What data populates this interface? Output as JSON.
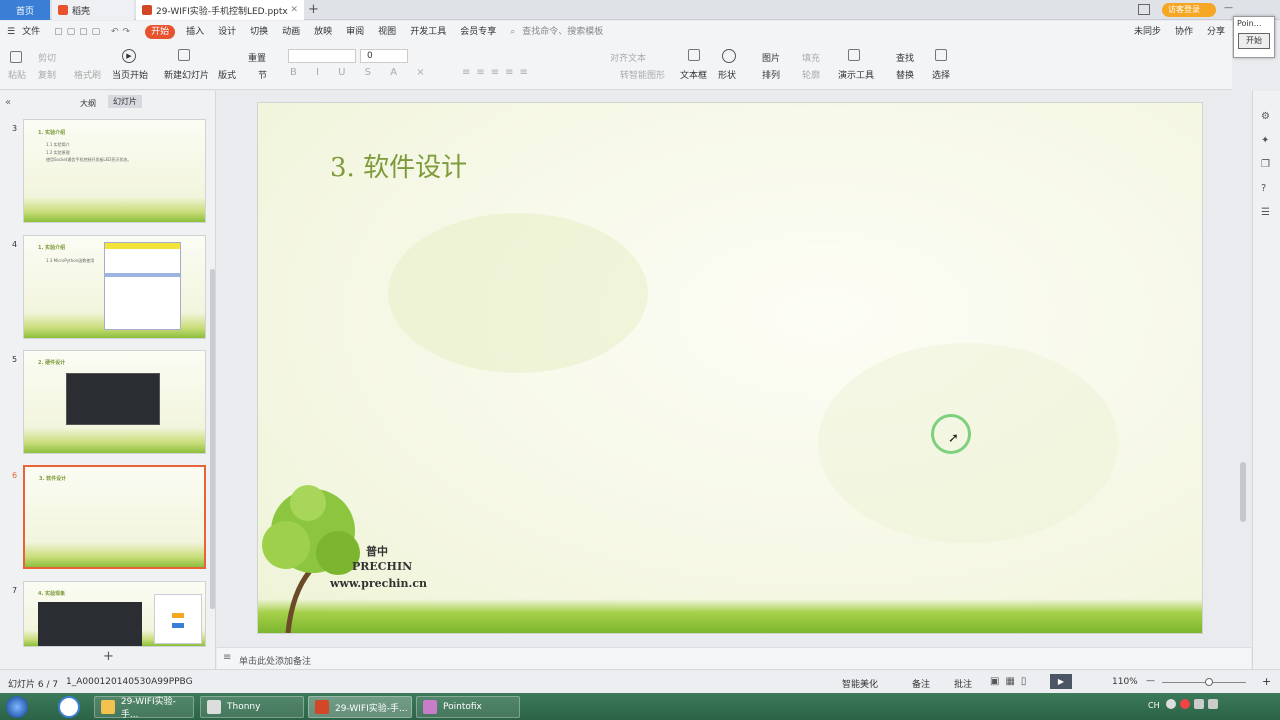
{
  "tabs": {
    "home": "首页",
    "t1": "稻壳",
    "t2": "29-WIFI实验-手机控制LED.pptx",
    "add": "+"
  },
  "title_right": {
    "login": "访客登录",
    "window_btns": [
      "—",
      "❐",
      "✕"
    ]
  },
  "pointofix": {
    "title": "Poin...",
    "start": "开始"
  },
  "menu": {
    "file": "文件",
    "items": [
      "开始",
      "插入",
      "设计",
      "切换",
      "动画",
      "放映",
      "审阅",
      "视图",
      "开发工具",
      "会员专享"
    ],
    "search": "查找命令、搜索模板",
    "sync": "未同步",
    "collab": "协作",
    "share": "分享"
  },
  "ribbon": {
    "paste": "粘贴",
    "cut": "剪切",
    "copy": "复制",
    "format_painter": "格式刷",
    "play_from_start": "当页开始",
    "new_slide": "新建幻灯片",
    "layout": "版式",
    "section": "节",
    "reset": "重置",
    "font_size": "0",
    "text_box": "文本框",
    "shape": "形状",
    "arrange": "排列",
    "picture": "图片",
    "fill": "填充",
    "outline": "轮廓",
    "presenter_tools": "演示工具",
    "find": "查找",
    "replace": "替换",
    "select": "选择",
    "align_text": "对齐文本",
    "smart_graphic": "转智能图形"
  },
  "panel": {
    "outline_tab": "大纲",
    "slides_tab": "幻灯片",
    "add_slide": "+"
  },
  "thumbs": [
    {
      "num": "3",
      "title": "1. 实验介绍",
      "lines": [
        "1.1 实验简介",
        "1.2 实验原理",
        "使用Socket通信手机控制开发板LED亮灭状态。"
      ]
    },
    {
      "num": "4",
      "title": "1. 实验介绍",
      "lines": [
        "1.3 MicroPython函数使用"
      ]
    },
    {
      "num": "5",
      "title": "2. 硬件设计",
      "lines": []
    },
    {
      "num": "6",
      "title": "3. 软件设计",
      "lines": []
    },
    {
      "num": "7",
      "title": "4. 实验现象",
      "lines": []
    }
  ],
  "slide": {
    "title": "3. 软件设计",
    "logo_cn": "普中",
    "logo_en": "PRECHIN",
    "logo_url": "www.prechin.cn"
  },
  "notes_placeholder": "单击此处添加备注",
  "status": {
    "slide_pos": "幻灯片 6 / 7",
    "id": "1_A000120140530A99PPBG",
    "beautify": "智能美化",
    "notes": "备注",
    "comments": "批注",
    "zoom": "110%",
    "minus": "—",
    "plus": "+"
  },
  "taskbar": {
    "items": [
      "29-WIFI实验-手...",
      "Thonny",
      "29-WIFI实验-手...",
      "Pointofix"
    ],
    "tray_lang": "CH"
  },
  "colors": {
    "accent": "#e8532f",
    "title_green": "#7d9b3a",
    "taskbar": "#2f6b4c"
  }
}
